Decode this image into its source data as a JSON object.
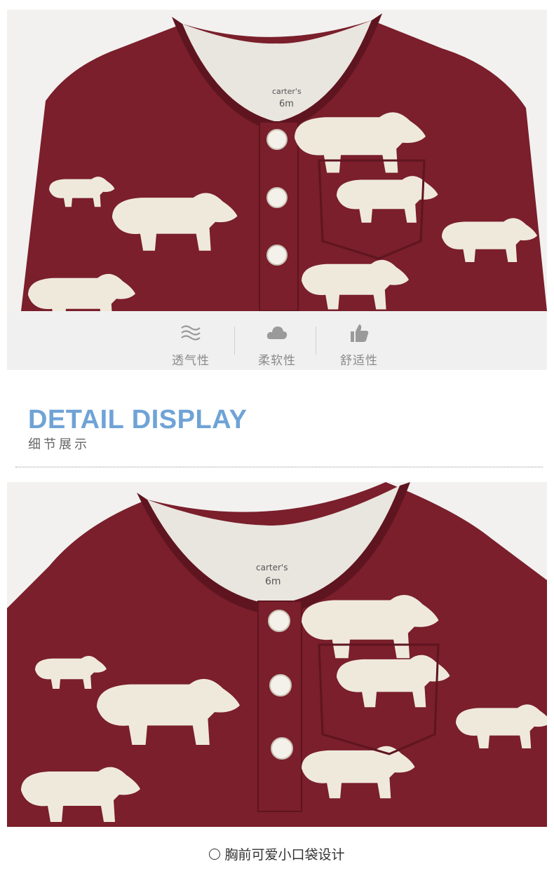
{
  "colors": {
    "fabric": "#7a1f2b",
    "fabric_dark": "#5e1520",
    "bear": "#efe9dc",
    "accent_title": "#6fa3d6",
    "icon_gray": "#9a9a9a"
  },
  "photo_top": {
    "neck_label_brand": "carter's",
    "neck_label_size": "6m"
  },
  "features": [
    {
      "icon": "waves-icon",
      "label": "透气性"
    },
    {
      "icon": "cloud-icon",
      "label": "柔软性"
    },
    {
      "icon": "thumbs-up-icon",
      "label": "舒适性"
    }
  ],
  "section": {
    "title": "DETAIL DISPLAY",
    "subtitle": "细节展示"
  },
  "photo_bottom": {
    "neck_label_brand": "carter's",
    "neck_label_size": "6m"
  },
  "caption": "胸前可爱小口袋设计"
}
